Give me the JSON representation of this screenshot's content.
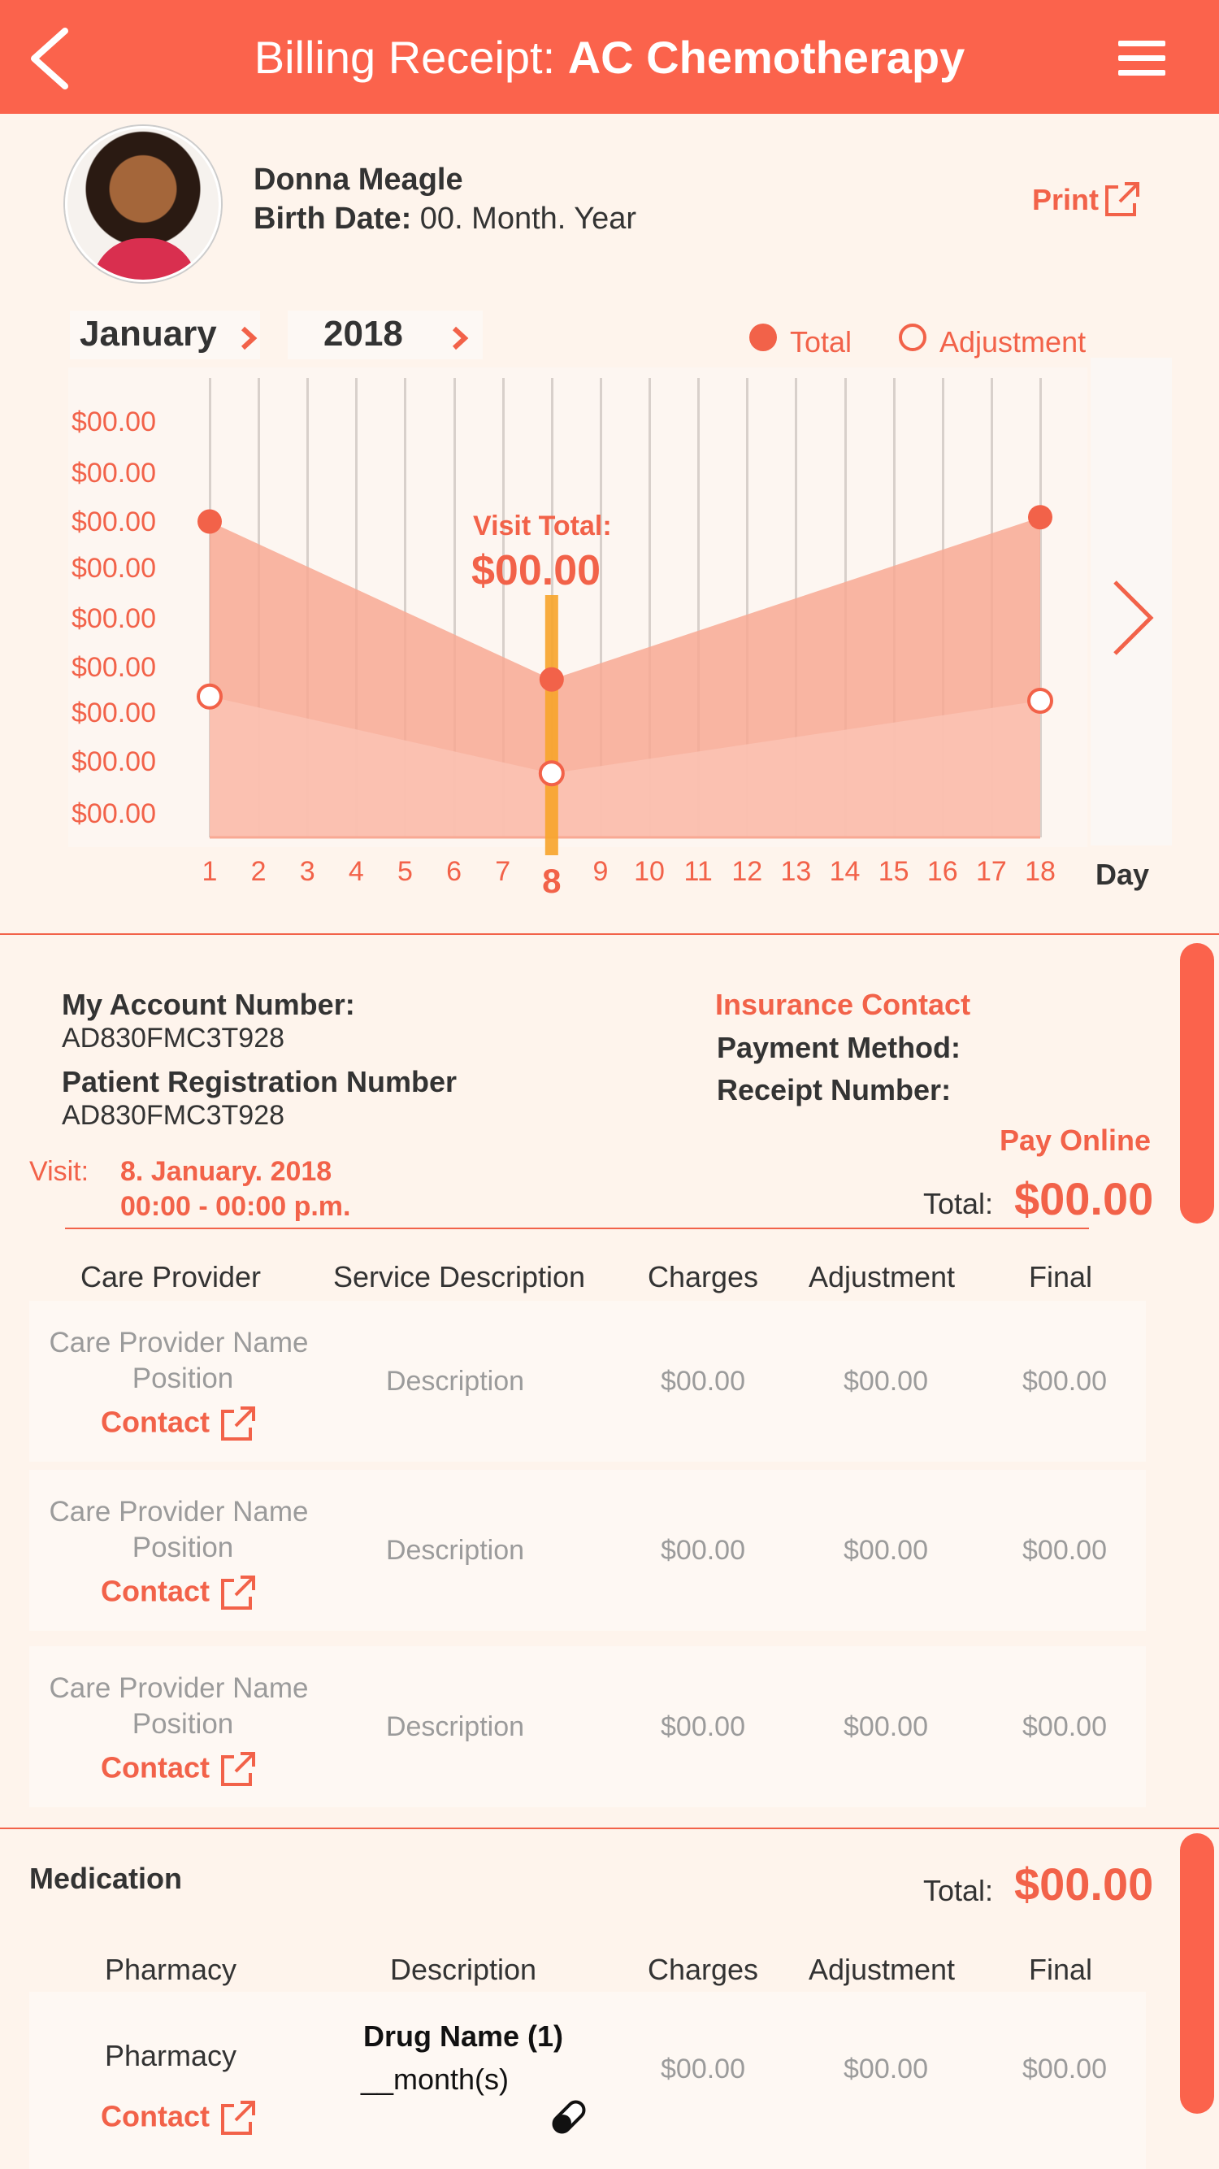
{
  "header": {
    "title_prefix": "Billing Receipt: ",
    "title_bold": "AC Chemotherapy"
  },
  "patient": {
    "name": "Donna Meagle",
    "birth_label": "Birth Date:",
    "birth_value": "00. Month. Year",
    "print_label": "Print"
  },
  "chart_controls": {
    "month": "January",
    "year": "2018",
    "legend_total": "Total",
    "legend_adjustment": "Adjustment"
  },
  "chart_data": {
    "type": "area",
    "x": [
      1,
      2,
      3,
      4,
      5,
      6,
      7,
      8,
      9,
      10,
      11,
      12,
      13,
      14,
      15,
      16,
      17,
      18
    ],
    "xlabel": "Day",
    "selected_x": 8,
    "y_tick_labels": [
      "$00.00",
      "$00.00",
      "$00.00",
      "$00.00",
      "$00.00",
      "$00.00",
      "$00.00",
      "$00.00",
      "$00.00"
    ],
    "series": [
      {
        "name": "Total",
        "points": [
          [
            1,
            0.74
          ],
          [
            8,
            0.37
          ],
          [
            18,
            0.75
          ]
        ]
      },
      {
        "name": "Adjustment",
        "points": [
          [
            1,
            0.33
          ],
          [
            8,
            0.15
          ],
          [
            18,
            0.32
          ]
        ]
      }
    ],
    "annotation_label": "Visit Total:",
    "annotation_value": "$00.00",
    "colors": {
      "total": "#f26249",
      "adjustment": "#f8a994",
      "selection": "#f7a42a"
    }
  },
  "account": {
    "account_label": "My Account Number:",
    "account_value": "AD830FMC3T928",
    "registration_label": "Patient Registration Number",
    "registration_value": "AD830FMC3T928",
    "insurance_contact": "Insurance Contact",
    "payment_method_label": "Payment Method:",
    "receipt_number_label": "Receipt Number:",
    "pay_online": "Pay Online",
    "visit_label": "Visit:",
    "visit_date": "8. January. 2018",
    "visit_time": "00:00 - 00:00 p.m.",
    "total_label": "Total:",
    "total_value": "$00.00"
  },
  "services_table": {
    "headers": [
      "Care Provider",
      "Service Description",
      "Charges",
      "Adjustment",
      "Final"
    ],
    "rows": [
      {
        "provider": "Care Provider Name",
        "position": "Position",
        "contact": "Contact",
        "description": "Description",
        "charges": "$00.00",
        "adjustment": "$00.00",
        "final": "$00.00"
      },
      {
        "provider": "Care Provider Name",
        "position": "Position",
        "contact": "Contact",
        "description": "Description",
        "charges": "$00.00",
        "adjustment": "$00.00",
        "final": "$00.00"
      },
      {
        "provider": "Care Provider Name",
        "position": "Position",
        "contact": "Contact",
        "description": "Description",
        "charges": "$00.00",
        "adjustment": "$00.00",
        "final": "$00.00"
      }
    ]
  },
  "medication": {
    "title": "Medication",
    "total_label": "Total:",
    "total_value": "$00.00",
    "headers": [
      "Pharmacy",
      "Description",
      "Charges",
      "Adjustment",
      "Final"
    ],
    "rows": [
      {
        "pharmacy": "Pharmacy",
        "contact": "Contact",
        "drug": "Drug Name (1)",
        "duration": "__month(s)",
        "charges": "$00.00",
        "adjustment": "$00.00",
        "final": "$00.00"
      }
    ]
  },
  "icons": [
    "back-icon",
    "menu-icon",
    "external-link-icon",
    "chevron-right-icon",
    "pill-icon"
  ]
}
